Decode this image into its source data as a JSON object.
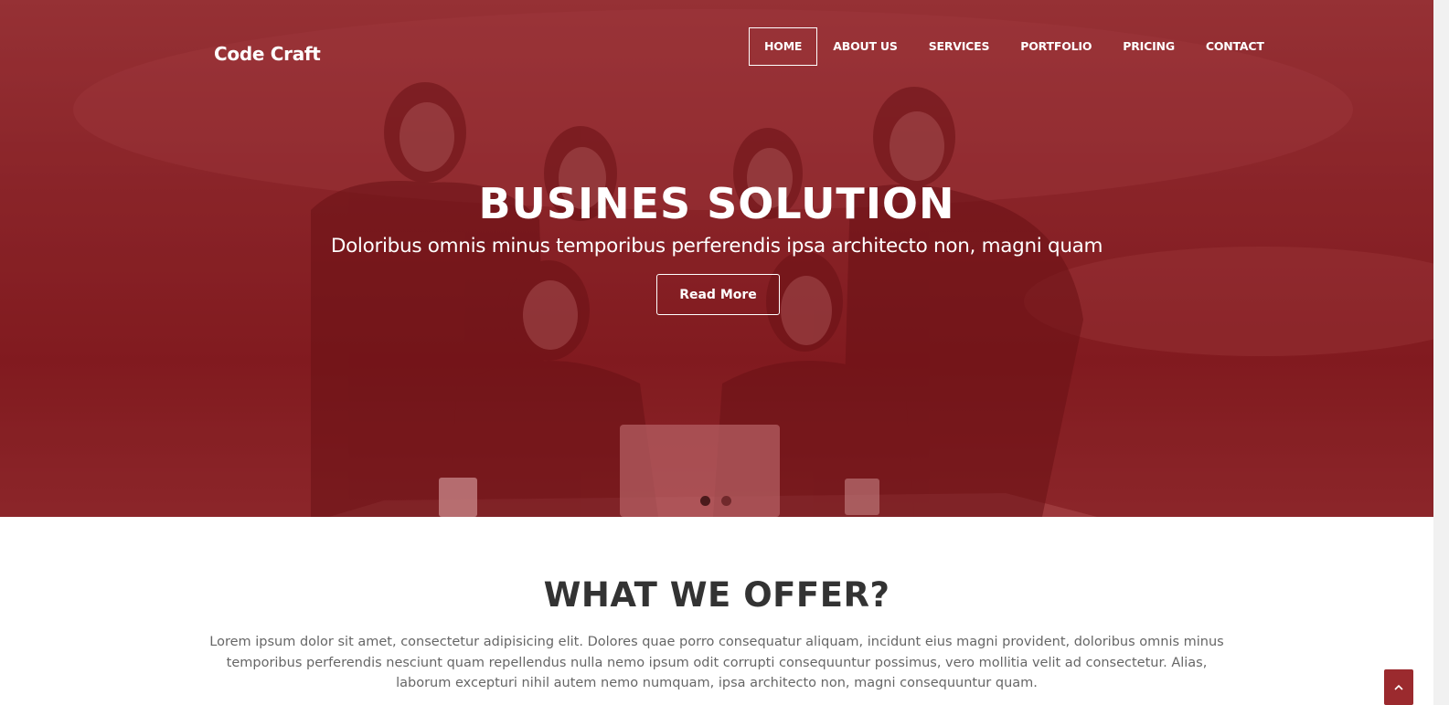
{
  "brand": {
    "logo_text": "Code Craft"
  },
  "nav": {
    "items": [
      {
        "label": "HOME",
        "active": true
      },
      {
        "label": "ABOUT US",
        "active": false
      },
      {
        "label": "SERVICES",
        "active": false
      },
      {
        "label": "PORTFOLIO",
        "active": false
      },
      {
        "label": "PRICING",
        "active": false
      },
      {
        "label": "CONTACT",
        "active": false
      }
    ]
  },
  "hero": {
    "title": "BUSINES SOLUTION",
    "subtitle": "Doloribus omnis minus temporibus perferendis ipsa architecto non, magni quam",
    "button_label": "Read More",
    "slides": {
      "count": 2,
      "active_index": 0
    }
  },
  "offer": {
    "title": "WHAT WE OFFER?",
    "text": "Lorem ipsum dolor sit amet, consectetur adipisicing elit. Dolores quae porro consequatur aliquam, incidunt eius magni provident, doloribus omnis minus temporibus perferendis nesciunt quam repellendus nulla nemo ipsum odit corrupti consequuntur possimus, vero mollitia velit ad consectetur. Alias, laborum excepturi nihil autem nemo numquam, ipsa architecto non, magni consequuntur quam."
  },
  "icons": {
    "back_to_top": "chevron-up-icon"
  },
  "colors": {
    "hero_tint": "#8a2a2f",
    "accent": "#9b2a2e",
    "heading": "#333333",
    "body_text": "#666666"
  }
}
